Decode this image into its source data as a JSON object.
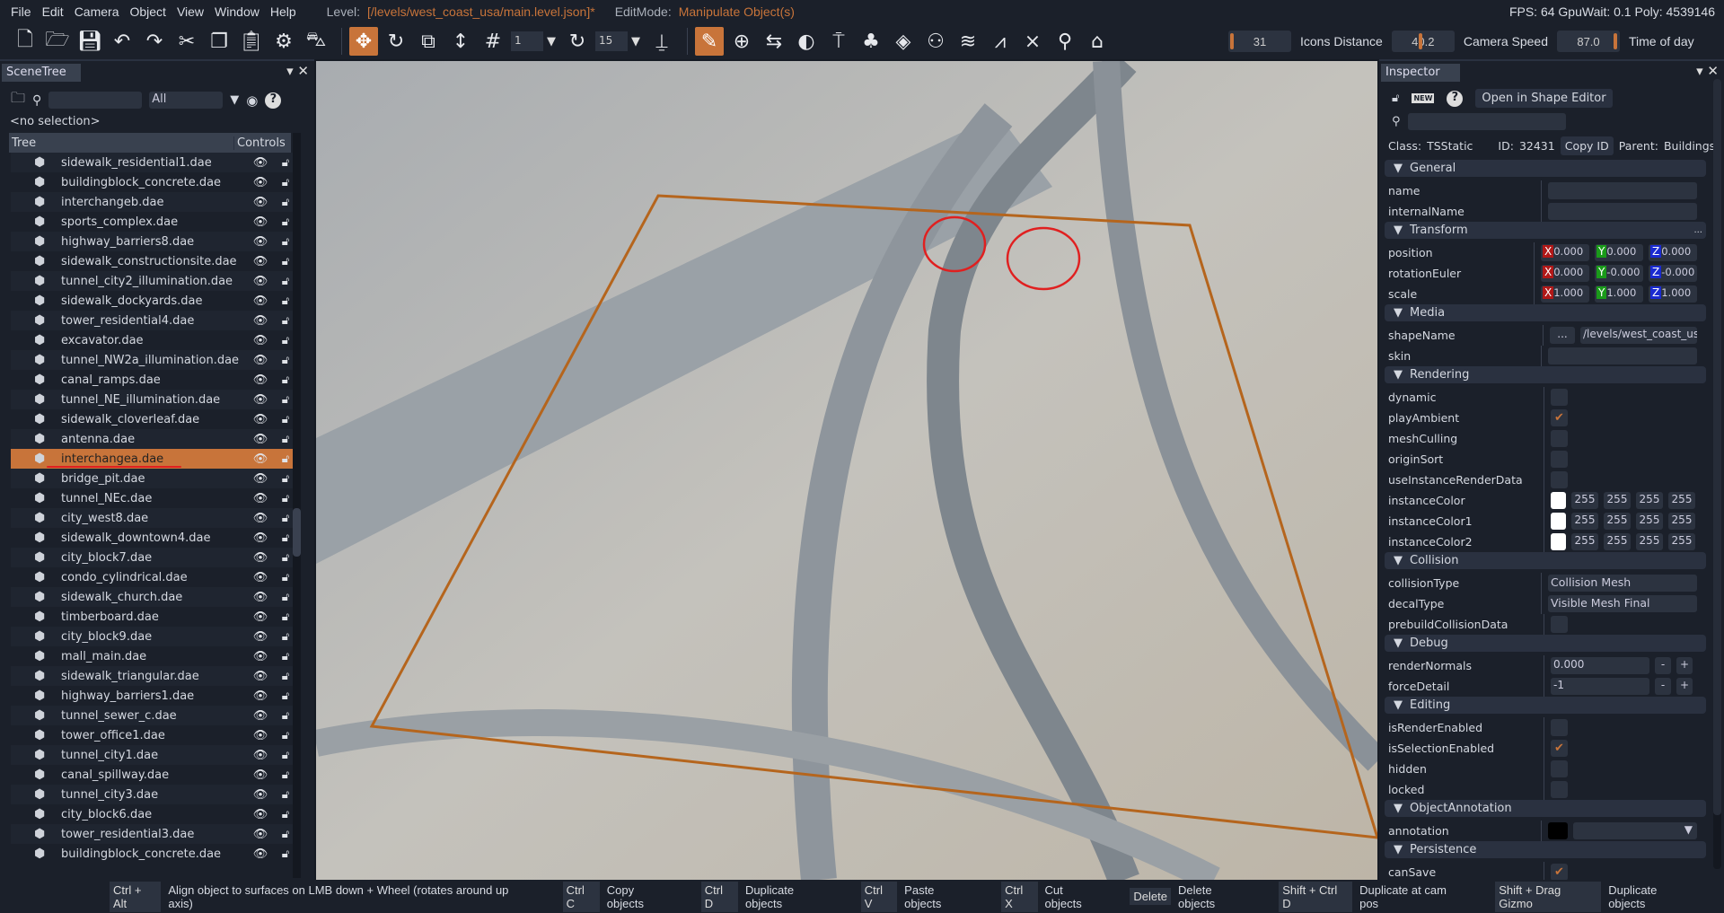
{
  "menu": {
    "items": [
      "File",
      "Edit",
      "Camera",
      "Object",
      "View",
      "Window",
      "Help"
    ],
    "level_label": "Level:",
    "level_value": "[/levels/west_coast_usa/main.level.json]*",
    "editmode_label": "EditMode:",
    "editmode_value": "Manipulate Object(s)",
    "stats": "FPS: 64  GpuWait: 0.1  Poly: 4539146"
  },
  "toolbar": {
    "file_icons": [
      "new-file-icon",
      "open-folder-icon",
      "save-icon",
      "undo-icon",
      "redo-icon",
      "cut-icon",
      "copy-icon",
      "paste-icon",
      "settings-gear-icon",
      "vehicle-car-icon"
    ],
    "transform_icons": [
      "translate-icon",
      "rotate-icon",
      "scale-icon",
      "world-local-axis-icon",
      "grid-snap-icon"
    ],
    "grid_snap_value": "1",
    "rotate_snap_value": "15",
    "tool_icons": [
      "pencil-edit-icon",
      "add-circle-icon",
      "road-icon",
      "terrain-icon",
      "paint-roller-icon",
      "forest-tree-icon",
      "decal-layers-icon",
      "object-placement-icon",
      "river-icon",
      "mesh-road-icon",
      "sites-icon",
      "sensor-icon",
      "robot-icon"
    ],
    "slider1_value": "31",
    "slider1_fill": 0.0,
    "icons_distance_label": "Icons Distance",
    "icons_distance_value": "40.2",
    "camera_speed_label": "Camera Speed",
    "camera_speed_value": "87.0",
    "time_of_day_label": "Time of day"
  },
  "scenetree": {
    "tab": "SceneTree",
    "filter_value": "All",
    "search_placeholder": "",
    "selection": "<no selection>",
    "col_tree": "Tree",
    "col_controls": "Controls",
    "items": [
      "sidewalk_residential1.dae",
      "buildingblock_concrete.dae",
      "interchangeb.dae",
      "sports_complex.dae",
      "highway_barriers8.dae",
      "sidewalk_constructionsite.dae",
      "tunnel_city2_illumination.dae",
      "sidewalk_dockyards.dae",
      "tower_residential4.dae",
      "excavator.dae",
      "tunnel_NW2a_illumination.dae",
      "canal_ramps.dae",
      "tunnel_NE_illumination.dae",
      "sidewalk_cloverleaf.dae",
      "antenna.dae",
      "interchangea.dae",
      "bridge_pit.dae",
      "tunnel_NEc.dae",
      "city_west8.dae",
      "sidewalk_downtown4.dae",
      "city_block7.dae",
      "condo_cylindrical.dae",
      "sidewalk_church.dae",
      "timberboard.dae",
      "city_block9.dae",
      "mall_main.dae",
      "sidewalk_triangular.dae",
      "highway_barriers1.dae",
      "tunnel_sewer_c.dae",
      "tower_office1.dae",
      "tunnel_city1.dae",
      "canal_spillway.dae",
      "tunnel_city3.dae",
      "city_block6.dae",
      "tower_residential3.dae",
      "buildingblock_concrete.dae"
    ],
    "selected_index": 15
  },
  "inspector": {
    "tab": "Inspector",
    "open_shape_editor": "Open in Shape Editor",
    "class_label": "Class:",
    "class_value": "TSStatic",
    "id_label": "ID:",
    "id_value": "32431",
    "copy_id": "Copy ID",
    "parent_label": "Parent:",
    "parent_value": "Buildings",
    "sections": {
      "general": "General",
      "transform": "Transform",
      "media": "Media",
      "rendering": "Rendering",
      "collision": "Collision",
      "debug": "Debug",
      "editing": "Editing",
      "annotation": "ObjectAnnotation",
      "persistence": "Persistence"
    },
    "fields": {
      "name": "name",
      "internalName": "internalName",
      "position": "position",
      "rotationEuler": "rotationEuler",
      "scale": "scale",
      "shapeName": "shapeName",
      "shapeName_value": "/levels/west_coast_usa",
      "shapeName_browse": "...",
      "skin": "skin",
      "dynamic": "dynamic",
      "playAmbient": "playAmbient",
      "meshCulling": "meshCulling",
      "originSort": "originSort",
      "useInstanceRenderData": "useInstanceRenderData",
      "instanceColor": "instanceColor",
      "instanceColor1": "instanceColor1",
      "instanceColor2": "instanceColor2",
      "collisionType": "collisionType",
      "collisionType_value": "Collision Mesh",
      "decalType": "decalType",
      "decalType_value": "Visible Mesh Final",
      "prebuildCollisionData": "prebuildCollisionData",
      "renderNormals": "renderNormals",
      "renderNormals_value": "0.000",
      "forceDetail": "forceDetail",
      "forceDetail_value": "-1",
      "isRenderEnabled": "isRenderEnabled",
      "isSelectionEnabled": "isSelectionEnabled",
      "hidden": "hidden",
      "locked": "locked",
      "annotation": "annotation",
      "canSave": "canSave"
    },
    "position": {
      "x": "0.000",
      "y": "0.000",
      "z": "0.000"
    },
    "rotation": {
      "x": "0.000",
      "y": "-0.000",
      "z": "-0.000"
    },
    "scale": {
      "x": "1.000",
      "y": "1.000",
      "z": "1.000"
    },
    "color_value": "255",
    "minus": "-",
    "plus": "+",
    "transform_more": "...",
    "axis": {
      "x": "X",
      "y": "Y",
      "z": "Z"
    },
    "checks": {
      "dynamic": false,
      "playAmbient": true,
      "meshCulling": false,
      "originSort": false,
      "useInstanceRenderData": false,
      "prebuildCollisionData": false,
      "isRenderEnabled": false,
      "isSelectionEnabled": true,
      "hidden": false,
      "locked": false,
      "canSave": true
    }
  },
  "statusbar": [
    {
      "key": "Ctrl + Alt",
      "desc": "Align object to surfaces on LMB down + Wheel (rotates around up axis)"
    },
    {
      "key": "Ctrl C",
      "desc": "Copy objects"
    },
    {
      "key": "Ctrl D",
      "desc": "Duplicate objects"
    },
    {
      "key": "Ctrl V",
      "desc": "Paste objects"
    },
    {
      "key": "Ctrl X",
      "desc": "Cut objects"
    },
    {
      "key": "Delete",
      "desc": "Delete objects"
    },
    {
      "key": "Shift + Ctrl D",
      "desc": "Duplicate at cam pos"
    },
    {
      "key": "Shift + Drag Gizmo",
      "desc": "Duplicate objects"
    }
  ],
  "colors": {
    "accent": "#c8743a",
    "panel": "#1b202a",
    "selection_box": "#b5651d",
    "annotation_red": "#e02020"
  }
}
